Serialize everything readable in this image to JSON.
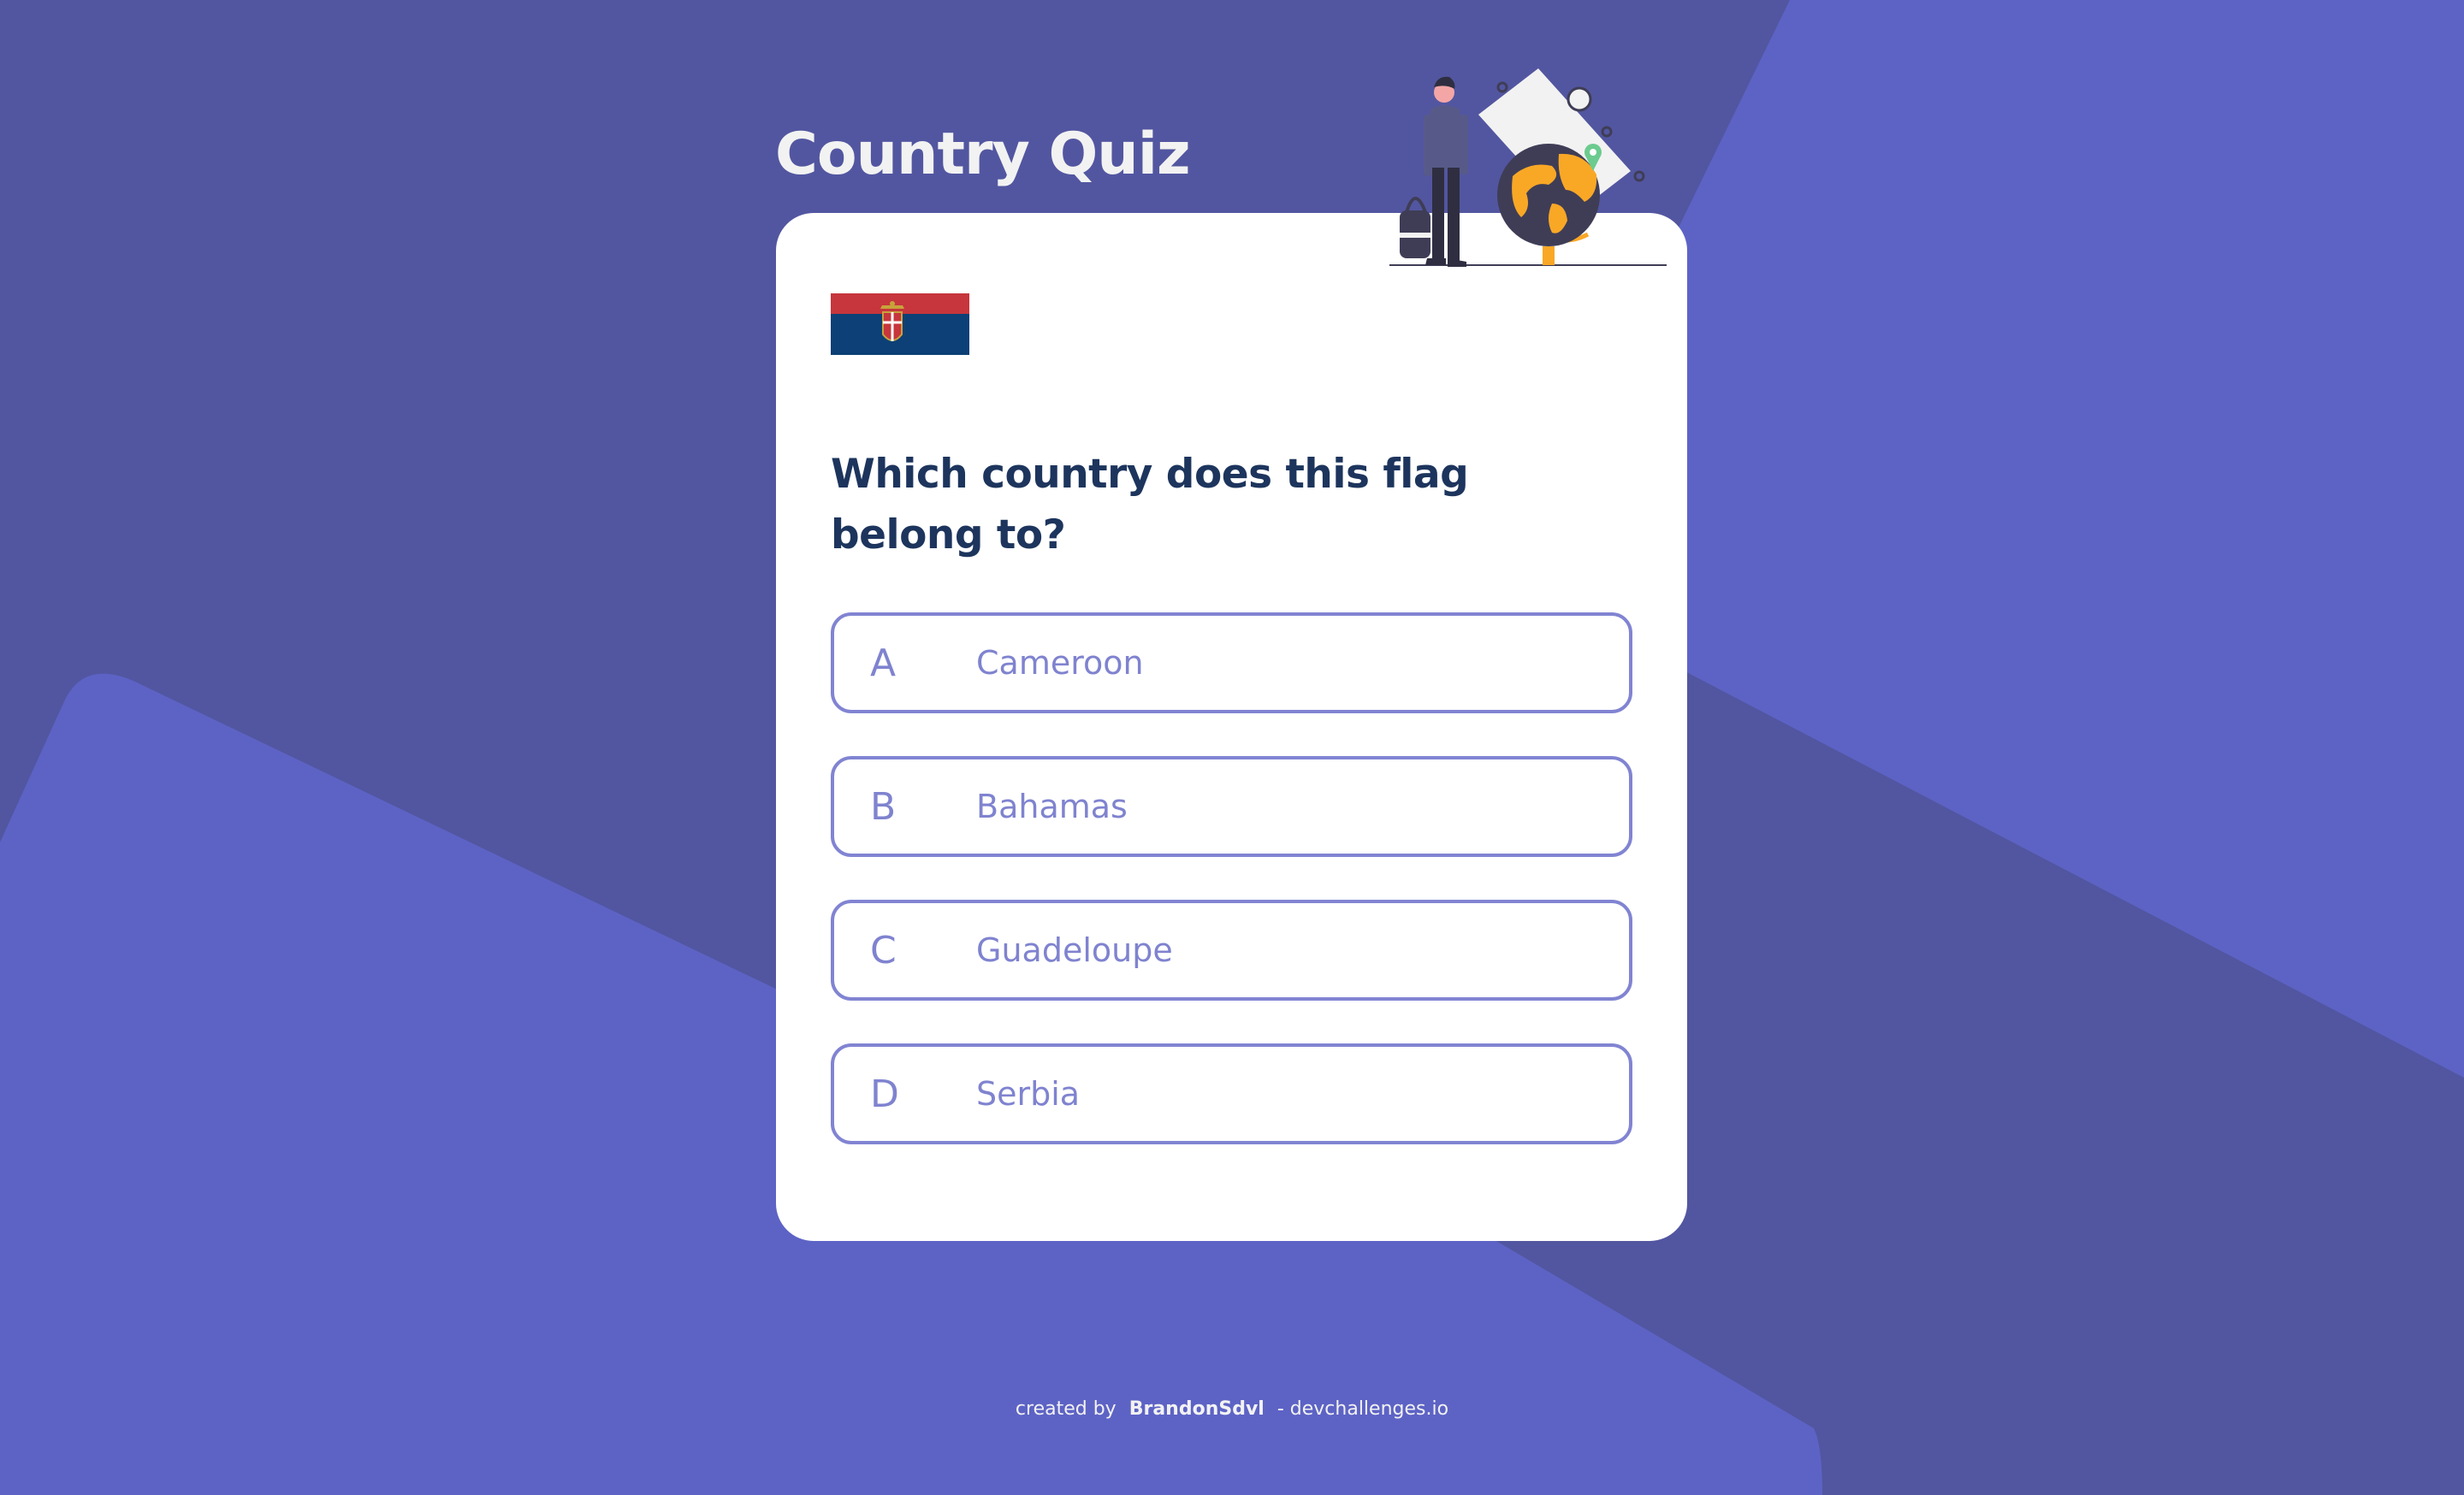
{
  "app": {
    "title": "Country Quiz"
  },
  "quiz": {
    "flag_country_icon": "serbia-flag-icon",
    "question": "Which country does this flag belong to?",
    "options": [
      {
        "letter": "A",
        "label": "Cameroon"
      },
      {
        "letter": "B",
        "label": "Bahamas"
      },
      {
        "letter": "C",
        "label": "Guadeloupe"
      },
      {
        "letter": "D",
        "label": "Serbia"
      }
    ]
  },
  "footer": {
    "prefix": "created by",
    "author": "BrandonSdvl",
    "separator": "-",
    "site": "devchallenges.io"
  },
  "colors": {
    "background": "#5256A0",
    "background_accent": "#5D63C5",
    "card": "#FFFFFF",
    "title": "#F2F2F2",
    "question": "#1D355D",
    "option_border": "#8184D2",
    "option_text": "#7F83CF",
    "globe": "#F9A826"
  }
}
